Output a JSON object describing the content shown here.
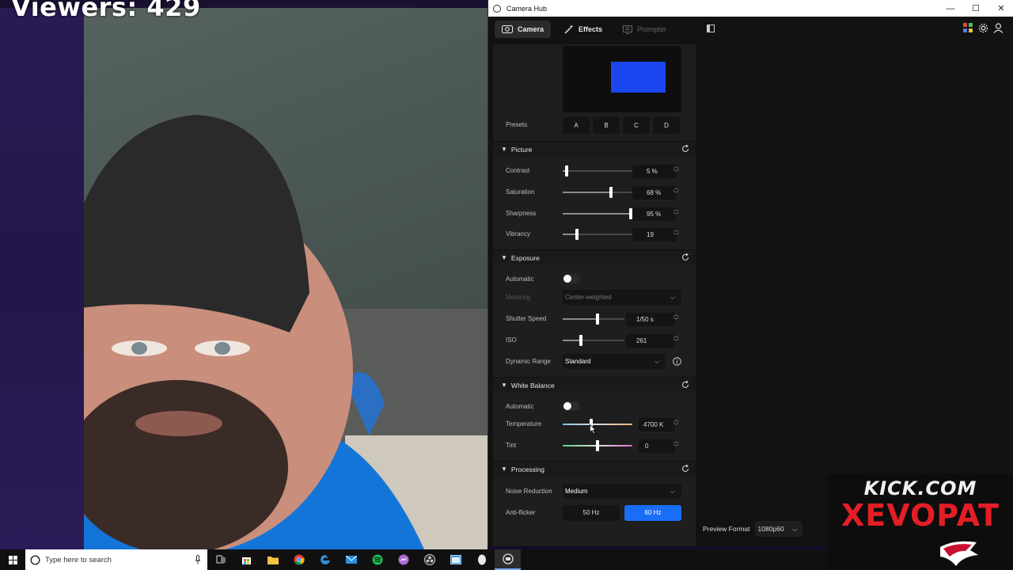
{
  "stream": {
    "viewers": "Viewers: 429"
  },
  "window": {
    "title": "Camera Hub",
    "controls": [
      "—",
      "☐",
      "✕"
    ]
  },
  "tabs": [
    {
      "label": "Camera",
      "state": "active"
    },
    {
      "label": "Effects",
      "state": "normal"
    },
    {
      "label": "Prompter",
      "state": "disabled"
    }
  ],
  "presets": {
    "label": "Presets",
    "buttons": [
      "A",
      "B",
      "C",
      "D"
    ]
  },
  "picture": {
    "title": "Picture",
    "rows": [
      {
        "label": "Contrast",
        "value": "5 %",
        "level": 0.05
      },
      {
        "label": "Saturation",
        "value": "68 %",
        "level": 0.68
      },
      {
        "label": "Sharpness",
        "value": "95 %",
        "level": 0.95
      },
      {
        "label": "Vibrancy",
        "value": "19",
        "level": 0.2
      }
    ]
  },
  "exposure": {
    "title": "Exposure",
    "automatic_label": "Automatic",
    "metering_label": "Metering",
    "metering_value": "Center-weighted",
    "shutter_label": "Shutter Speed",
    "shutter_value": "1/50 s",
    "shutter_level": 0.57,
    "iso_label": "ISO",
    "iso_value": "261",
    "iso_level": 0.29,
    "dynamic_label": "Dynamic Range",
    "dynamic_value": "Standard"
  },
  "white_balance": {
    "title": "White Balance",
    "automatic_label": "Automatic",
    "temperature_label": "Temperature",
    "temperature_value": "4700 K",
    "temperature_level": 0.41,
    "tint_label": "Tint",
    "tint_value": "0",
    "tint_level": 0.5
  },
  "processing": {
    "title": "Processing",
    "noise_label": "Noise Reduction",
    "noise_value": "Medium",
    "antiflicker_label": "Anti-flicker",
    "hz_options": [
      "50 Hz",
      "60 Hz"
    ],
    "hz_selected": "60 Hz"
  },
  "preview_format": {
    "label": "Preview Format",
    "value": "1080p60"
  },
  "watermark": {
    "line1": "KICK.COM",
    "line2": "XEVOPAT"
  },
  "taskbar": {
    "search_placeholder": "Type here to search"
  },
  "colors": {
    "accent": "#1a6ef5",
    "preview_rect": "#1a47f0",
    "watermark_red": "#e41e26"
  }
}
